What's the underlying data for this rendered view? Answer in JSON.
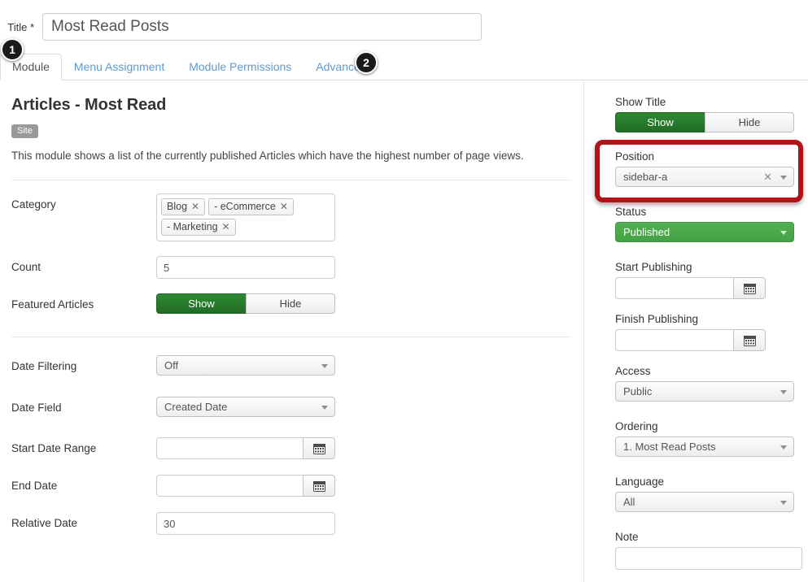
{
  "form": {
    "title_label": "Title *",
    "title_value": "Most Read Posts"
  },
  "tabs": [
    {
      "label": "Module",
      "active": true
    },
    {
      "label": "Menu Assignment",
      "active": false
    },
    {
      "label": "Module Permissions",
      "active": false
    },
    {
      "label": "Advanced",
      "active": false
    }
  ],
  "callouts": [
    {
      "number": "1"
    },
    {
      "number": "2"
    }
  ],
  "main": {
    "heading": "Articles - Most Read",
    "scope_badge": "Site",
    "description": "This module shows a list of the currently published Articles which have the highest number of page views.",
    "fields": {
      "category_label": "Category",
      "category_tags": [
        {
          "label": "Blog",
          "remove": "✕"
        },
        {
          "label": "- eCommerce",
          "remove": "✕"
        },
        {
          "label": "- Marketing",
          "remove": "✕"
        }
      ],
      "count_label": "Count",
      "count_value": "5",
      "featured_label": "Featured Articles",
      "featured_show": "Show",
      "featured_hide": "Hide",
      "featured_selected": "Show",
      "date_filtering_label": "Date Filtering",
      "date_filtering_value": "Off",
      "date_field_label": "Date Field",
      "date_field_value": "Created Date",
      "start_date_range_label": "Start Date Range",
      "start_date_range_value": "",
      "end_date_label": "End Date",
      "end_date_value": "",
      "relative_date_label": "Relative Date",
      "relative_date_value": "30"
    }
  },
  "sidebar": {
    "show_title_label": "Show Title",
    "show_title_show": "Show",
    "show_title_hide": "Hide",
    "show_title_selected": "Show",
    "position_label": "Position",
    "position_value": "sidebar-a",
    "position_clear": "✕",
    "status_label": "Status",
    "status_value": "Published",
    "start_publishing_label": "Start Publishing",
    "start_publishing_value": "",
    "finish_publishing_label": "Finish Publishing",
    "finish_publishing_value": "",
    "access_label": "Access",
    "access_value": "Public",
    "ordering_label": "Ordering",
    "ordering_value": "1. Most Read Posts",
    "language_label": "Language",
    "language_value": "All",
    "note_label": "Note",
    "note_value": ""
  },
  "colors": {
    "accent_green_dark": "#2e8b32",
    "accent_green_light": "#4cae4c",
    "link_blue": "#5b9bd5",
    "annotation_red": "#b01217",
    "badge_black": "#1b1b1b",
    "site_badge_gray": "#999999"
  }
}
